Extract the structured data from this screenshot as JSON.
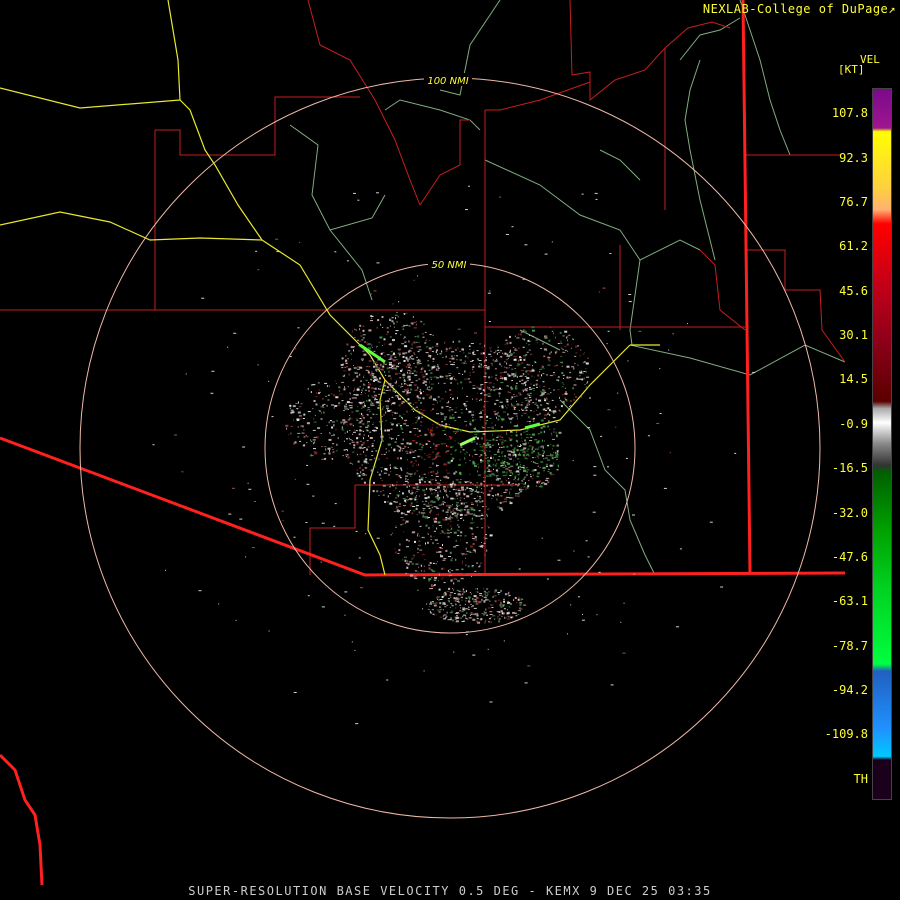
{
  "credit": "NEXLAB-College of DuPage",
  "credit_icon": "external-link-icon",
  "product": "SUPER-RESOLUTION BASE VELOCITY 0.5 DEG - KEMX 9 DEC 25 03:35",
  "legend": {
    "title": "VEL",
    "unit": "[KT]",
    "labels": [
      "107.8",
      "92.3",
      "76.7",
      "61.2",
      "45.6",
      "30.1",
      "14.5",
      "-0.9",
      "-16.5",
      "-32.0",
      "-47.6",
      "-63.1",
      "-78.7",
      "-94.2",
      "-109.8",
      "TH"
    ]
  },
  "rings": [
    {
      "label": "100 NMI"
    },
    {
      "label": "50 NMI"
    }
  ],
  "colors": {
    "boundary_thick": "#ff2020",
    "boundary_thin": "#c81e1e",
    "county": "#8fbf8f",
    "highway": "#ffff33",
    "ring": "#f0b8a8",
    "text": "#ffff33"
  }
}
